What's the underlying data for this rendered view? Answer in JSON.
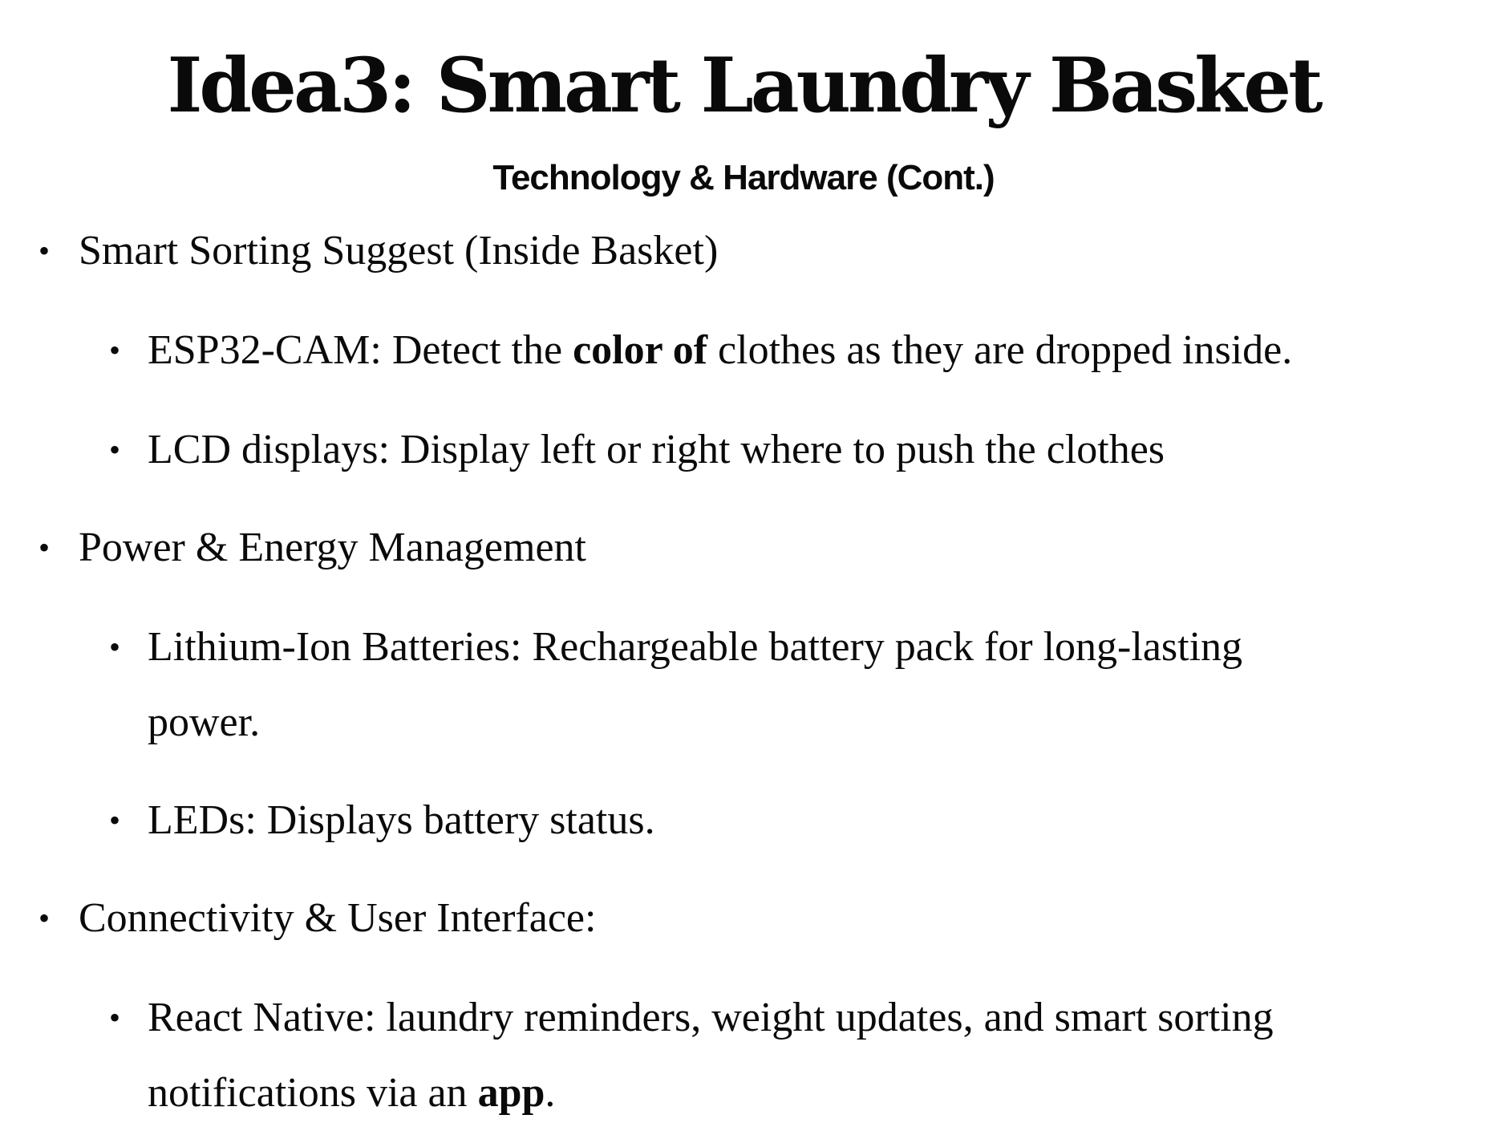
{
  "slide": {
    "title": "Idea3: Smart Laundry Basket",
    "subtitle": "Technology & Hardware (Cont.)",
    "bullet_glyph": "•",
    "items": [
      {
        "text": "Smart Sorting Suggest (Inside Basket)"
      },
      {
        "before": "ESP32-CAM: Detect the ",
        "bold": "color of",
        "after": " clothes as they are dropped inside."
      },
      {
        "text": "LCD displays: Display left or right where to push the clothes"
      },
      {
        "text": "Power & Energy Management"
      },
      {
        "line1": "Lithium-Ion Batteries: Rechargeable battery pack for long-lasting",
        "line2": "power."
      },
      {
        "text": "LEDs: Displays battery status."
      },
      {
        "text": "Connectivity & User Interface:"
      },
      {
        "line1": "React Native: laundry reminders, weight updates, and smart sorting",
        "line2_before": "notifications via an ",
        "line2_bold": "app",
        "line2_after": "."
      }
    ]
  }
}
